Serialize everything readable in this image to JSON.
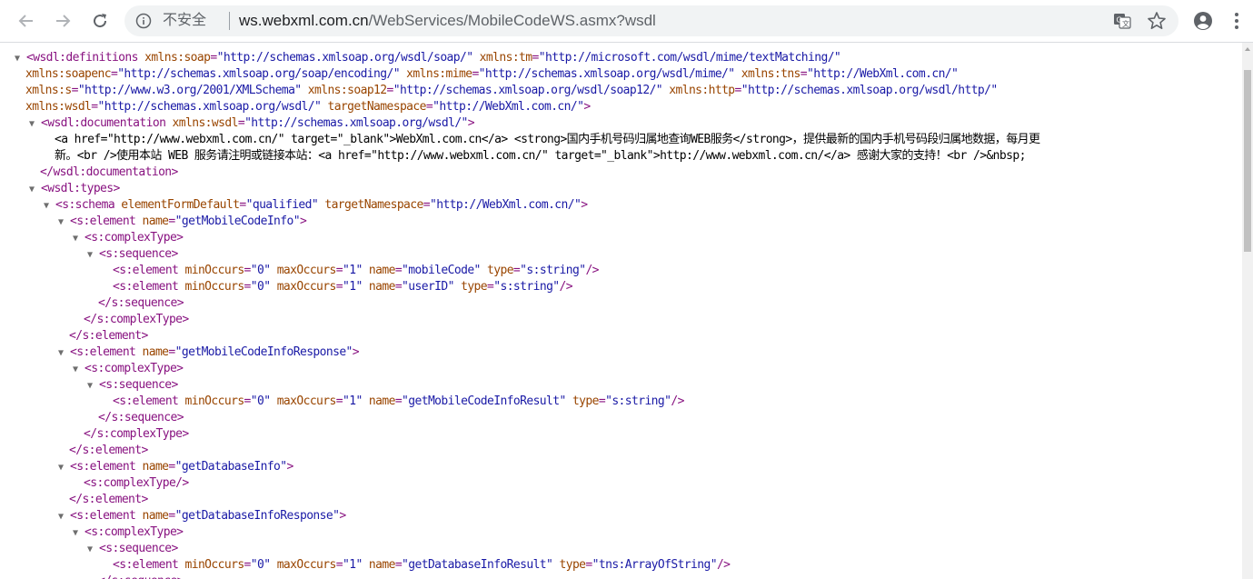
{
  "browser": {
    "security_label": "不安全",
    "url_host": "ws.webxml.com.cn",
    "url_path": "/WebServices/MobileCodeWS.asmx?wsdl",
    "icons": {
      "back": "back-arrow-icon",
      "forward": "forward-arrow-icon",
      "reload": "reload-icon",
      "info": "info-icon",
      "translate": "translate-icon",
      "bookmark": "star-icon",
      "profile": "account-icon",
      "menu": "more-vert-icon"
    },
    "colors": {
      "tag": "#881280",
      "attribute": "#994500",
      "value": "#1a1aa6",
      "text": "#000000"
    }
  },
  "xml": {
    "lines": [
      {
        "toggle": true,
        "segments": [
          [
            "tag",
            "<wsdl:definitions "
          ],
          [
            "attr",
            "xmlns:soap"
          ],
          [
            "tag",
            "="
          ],
          [
            "val",
            "\"http://schemas.xmlsoap.org/wsdl/soap/\""
          ],
          [
            "attr",
            " xmlns:tm"
          ],
          [
            "tag",
            "="
          ],
          [
            "val",
            "\"http://microsoft.com/wsdl/mime/textMatching/\""
          ]
        ]
      },
      {
        "toggle": false,
        "segments": [
          [
            "attr",
            "xmlns:soapenc"
          ],
          [
            "tag",
            "="
          ],
          [
            "val",
            "\"http://schemas.xmlsoap.org/soap/encoding/\""
          ],
          [
            "attr",
            " xmlns:mime"
          ],
          [
            "tag",
            "="
          ],
          [
            "val",
            "\"http://schemas.xmlsoap.org/wsdl/mime/\""
          ],
          [
            "attr",
            " xmlns:tns"
          ],
          [
            "tag",
            "="
          ],
          [
            "val",
            "\"http://WebXml.com.cn/\""
          ]
        ]
      },
      {
        "toggle": false,
        "segments": [
          [
            "attr",
            "xmlns:s"
          ],
          [
            "tag",
            "="
          ],
          [
            "val",
            "\"http://www.w3.org/2001/XMLSchema\""
          ],
          [
            "attr",
            " xmlns:soap12"
          ],
          [
            "tag",
            "="
          ],
          [
            "val",
            "\"http://schemas.xmlsoap.org/wsdl/soap12/\""
          ],
          [
            "attr",
            " xmlns:http"
          ],
          [
            "tag",
            "="
          ],
          [
            "val",
            "\"http://schemas.xmlsoap.org/wsdl/http/\""
          ]
        ]
      },
      {
        "toggle": false,
        "segments": [
          [
            "attr",
            "xmlns:wsdl"
          ],
          [
            "tag",
            "="
          ],
          [
            "val",
            "\"http://schemas.xmlsoap.org/wsdl/\""
          ],
          [
            "attr",
            " targetNamespace"
          ],
          [
            "tag",
            "="
          ],
          [
            "val",
            "\"http://WebXml.com.cn/\""
          ],
          [
            "tag",
            ">"
          ]
        ]
      },
      {
        "toggle": true,
        "segments": [
          [
            "tag",
            "<wsdl:documentation "
          ],
          [
            "attr",
            "xmlns:wsdl"
          ],
          [
            "tag",
            "="
          ],
          [
            "val",
            "\"http://schemas.xmlsoap.org/wsdl/\""
          ],
          [
            "tag",
            ">"
          ]
        ]
      },
      {
        "toggle": false,
        "segments": [
          [
            "txt",
            "<a href=\"http://www.webxml.com.cn/\" target=\"_blank\">WebXml.com.cn</a> <strong>国内手机号码归属地查询WEB服务</strong>，提供最新的国内手机号码段归属地数据，每月更"
          ]
        ]
      },
      {
        "toggle": false,
        "segments": [
          [
            "txt",
            "新。<br />使用本站 WEB 服务请注明或链接本站：<a href=\"http://www.webxml.com.cn/\" target=\"_blank\">http://www.webxml.com.cn/</a> 感谢大家的支持！<br />&nbsp;"
          ]
        ]
      },
      {
        "toggle": false,
        "segments": [
          [
            "tag",
            "</wsdl:documentation>"
          ]
        ]
      },
      {
        "toggle": true,
        "segments": [
          [
            "tag",
            "<wsdl:types>"
          ]
        ]
      },
      {
        "toggle": true,
        "segments": [
          [
            "tag",
            "<s:schema "
          ],
          [
            "attr",
            "elementFormDefault"
          ],
          [
            "tag",
            "="
          ],
          [
            "val",
            "\"qualified\""
          ],
          [
            "attr",
            " targetNamespace"
          ],
          [
            "tag",
            "="
          ],
          [
            "val",
            "\"http://WebXml.com.cn/\""
          ],
          [
            "tag",
            ">"
          ]
        ]
      },
      {
        "toggle": true,
        "segments": [
          [
            "tag",
            "<s:element "
          ],
          [
            "attr",
            "name"
          ],
          [
            "tag",
            "="
          ],
          [
            "val",
            "\"getMobileCodeInfo\""
          ],
          [
            "tag",
            ">"
          ]
        ]
      },
      {
        "toggle": true,
        "segments": [
          [
            "tag",
            "<s:complexType>"
          ]
        ]
      },
      {
        "toggle": true,
        "segments": [
          [
            "tag",
            "<s:sequence>"
          ]
        ]
      },
      {
        "toggle": false,
        "segments": [
          [
            "tag",
            "<s:element "
          ],
          [
            "attr",
            "minOccurs"
          ],
          [
            "tag",
            "="
          ],
          [
            "val",
            "\"0\""
          ],
          [
            "attr",
            " maxOccurs"
          ],
          [
            "tag",
            "="
          ],
          [
            "val",
            "\"1\""
          ],
          [
            "attr",
            " name"
          ],
          [
            "tag",
            "="
          ],
          [
            "val",
            "\"mobileCode\""
          ],
          [
            "attr",
            " type"
          ],
          [
            "tag",
            "="
          ],
          [
            "val",
            "\"s:string\""
          ],
          [
            "tag",
            "/>"
          ]
        ]
      },
      {
        "toggle": false,
        "segments": [
          [
            "tag",
            "<s:element "
          ],
          [
            "attr",
            "minOccurs"
          ],
          [
            "tag",
            "="
          ],
          [
            "val",
            "\"0\""
          ],
          [
            "attr",
            " maxOccurs"
          ],
          [
            "tag",
            "="
          ],
          [
            "val",
            "\"1\""
          ],
          [
            "attr",
            " name"
          ],
          [
            "tag",
            "="
          ],
          [
            "val",
            "\"userID\""
          ],
          [
            "attr",
            " type"
          ],
          [
            "tag",
            "="
          ],
          [
            "val",
            "\"s:string\""
          ],
          [
            "tag",
            "/>"
          ]
        ]
      },
      {
        "toggle": false,
        "segments": [
          [
            "tag",
            "</s:sequence>"
          ]
        ]
      },
      {
        "toggle": false,
        "segments": [
          [
            "tag",
            "</s:complexType>"
          ]
        ]
      },
      {
        "toggle": false,
        "segments": [
          [
            "tag",
            "</s:element>"
          ]
        ]
      },
      {
        "toggle": true,
        "segments": [
          [
            "tag",
            "<s:element "
          ],
          [
            "attr",
            "name"
          ],
          [
            "tag",
            "="
          ],
          [
            "val",
            "\"getMobileCodeInfoResponse\""
          ],
          [
            "tag",
            ">"
          ]
        ]
      },
      {
        "toggle": true,
        "segments": [
          [
            "tag",
            "<s:complexType>"
          ]
        ]
      },
      {
        "toggle": true,
        "segments": [
          [
            "tag",
            "<s:sequence>"
          ]
        ]
      },
      {
        "toggle": false,
        "segments": [
          [
            "tag",
            "<s:element "
          ],
          [
            "attr",
            "minOccurs"
          ],
          [
            "tag",
            "="
          ],
          [
            "val",
            "\"0\""
          ],
          [
            "attr",
            " maxOccurs"
          ],
          [
            "tag",
            "="
          ],
          [
            "val",
            "\"1\""
          ],
          [
            "attr",
            " name"
          ],
          [
            "tag",
            "="
          ],
          [
            "val",
            "\"getMobileCodeInfoResult\""
          ],
          [
            "attr",
            " type"
          ],
          [
            "tag",
            "="
          ],
          [
            "val",
            "\"s:string\""
          ],
          [
            "tag",
            "/>"
          ]
        ]
      },
      {
        "toggle": false,
        "segments": [
          [
            "tag",
            "</s:sequence>"
          ]
        ]
      },
      {
        "toggle": false,
        "segments": [
          [
            "tag",
            "</s:complexType>"
          ]
        ]
      },
      {
        "toggle": false,
        "segments": [
          [
            "tag",
            "</s:element>"
          ]
        ]
      },
      {
        "toggle": true,
        "segments": [
          [
            "tag",
            "<s:element "
          ],
          [
            "attr",
            "name"
          ],
          [
            "tag",
            "="
          ],
          [
            "val",
            "\"getDatabaseInfo\""
          ],
          [
            "tag",
            ">"
          ]
        ]
      },
      {
        "toggle": false,
        "segments": [
          [
            "tag",
            "<s:complexType/>"
          ]
        ]
      },
      {
        "toggle": false,
        "segments": [
          [
            "tag",
            "</s:element>"
          ]
        ]
      },
      {
        "toggle": true,
        "segments": [
          [
            "tag",
            "<s:element "
          ],
          [
            "attr",
            "name"
          ],
          [
            "tag",
            "="
          ],
          [
            "val",
            "\"getDatabaseInfoResponse\""
          ],
          [
            "tag",
            ">"
          ]
        ]
      },
      {
        "toggle": true,
        "segments": [
          [
            "tag",
            "<s:complexType>"
          ]
        ]
      },
      {
        "toggle": true,
        "segments": [
          [
            "tag",
            "<s:sequence>"
          ]
        ]
      },
      {
        "toggle": false,
        "segments": [
          [
            "tag",
            "<s:element "
          ],
          [
            "attr",
            "minOccurs"
          ],
          [
            "tag",
            "="
          ],
          [
            "val",
            "\"0\""
          ],
          [
            "attr",
            " maxOccurs"
          ],
          [
            "tag",
            "="
          ],
          [
            "val",
            "\"1\""
          ],
          [
            "attr",
            " name"
          ],
          [
            "tag",
            "="
          ],
          [
            "val",
            "\"getDatabaseInfoResult\""
          ],
          [
            "attr",
            " type"
          ],
          [
            "tag",
            "="
          ],
          [
            "val",
            "\"tns:ArrayOfString\""
          ],
          [
            "tag",
            "/>"
          ]
        ]
      },
      {
        "toggle": false,
        "segments": [
          [
            "tag",
            "</s:sequence>"
          ]
        ]
      }
    ]
  }
}
